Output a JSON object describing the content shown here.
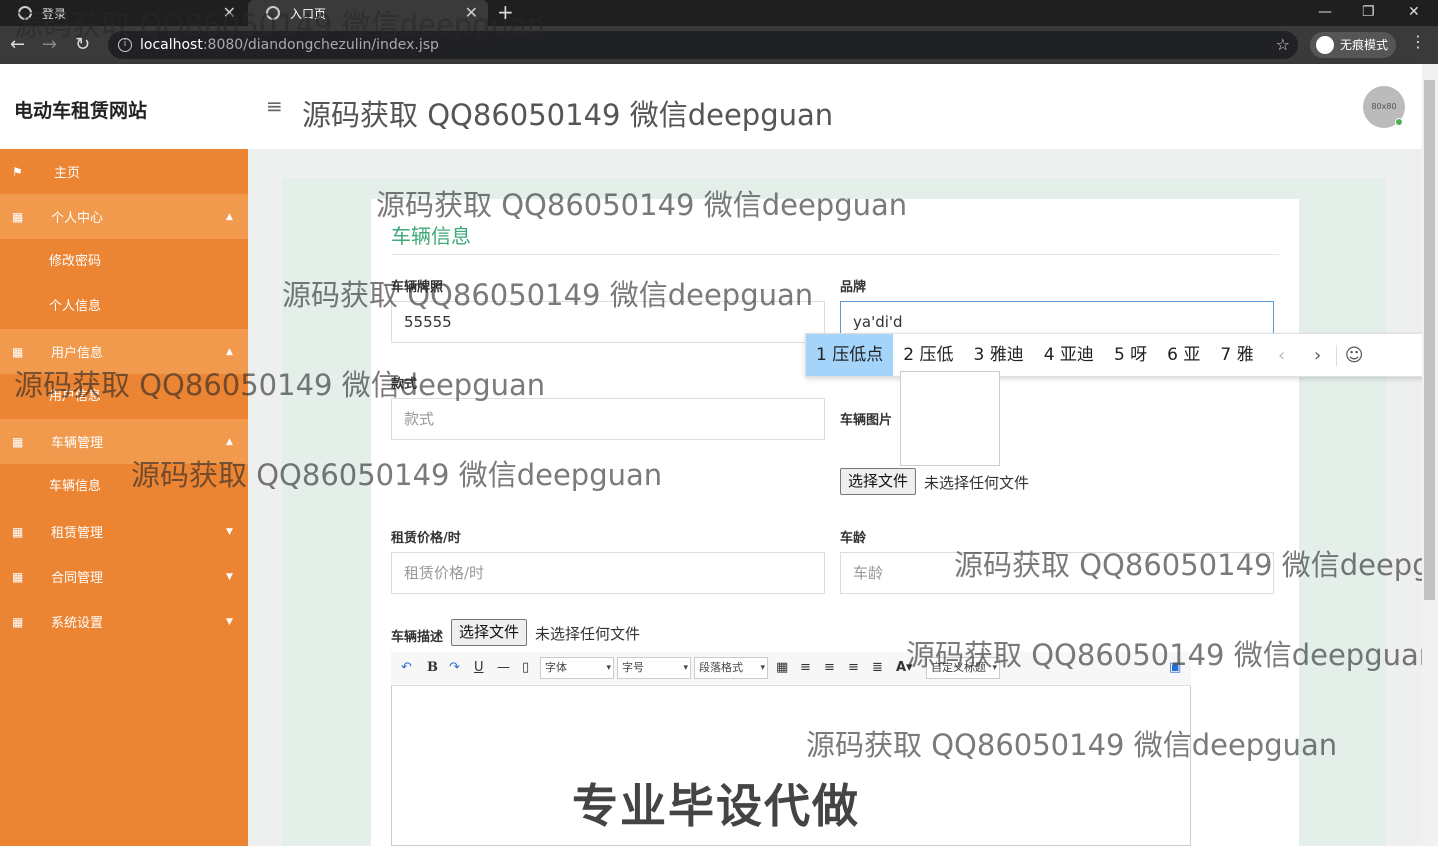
{
  "browser": {
    "tabs": [
      {
        "title": "登录"
      },
      {
        "title": "入口页"
      }
    ],
    "url_host": "localhost",
    "url_path": ":8080/diandongchezulin/index.jsp",
    "incognito_label": "无痕模式"
  },
  "header": {
    "brand": "电动车租赁网站",
    "banner_text": "源码获取 QQ86050149 微信deepguan",
    "avatar_text": "80x80"
  },
  "sidebar": {
    "items": [
      {
        "label": "主页"
      },
      {
        "label": "个人中心"
      },
      {
        "label": "修改密码"
      },
      {
        "label": "个人信息"
      },
      {
        "label": "用户信息"
      },
      {
        "label": "用户信息"
      },
      {
        "label": "车辆管理"
      },
      {
        "label": "车辆信息"
      },
      {
        "label": "租赁管理"
      },
      {
        "label": "合同管理"
      },
      {
        "label": "系统设置"
      }
    ]
  },
  "form": {
    "title": "车辆信息",
    "plate_label": "车辆牌照",
    "plate_value": "55555",
    "brand_label": "品牌",
    "brand_value": "ya'di'd",
    "style_label": "款式",
    "style_placeholder": "款式",
    "image_label": "车辆图片",
    "file_button": "选择文件",
    "file_none": "未选择任何文件",
    "price_label": "租赁价格/时",
    "price_placeholder": "租赁价格/时",
    "age_label": "车龄",
    "age_placeholder": "车龄",
    "desc_label": "车辆描述"
  },
  "ime": {
    "candidates": [
      "1 压低点",
      "2 压低",
      "3 雅迪",
      "4 亚迪",
      "5 呀",
      "6 亚",
      "7 雅"
    ]
  },
  "editor_toolbar": {
    "font": "字体",
    "size": "字号",
    "paragraph": "段落格式",
    "custom": "自定义标题"
  },
  "watermarks": {
    "text": "源码获取 QQ86050149 微信deepguan",
    "cut_text": "源码获取 QQ86050149 微信deepgu",
    "stamp": "专业毕设代做"
  }
}
